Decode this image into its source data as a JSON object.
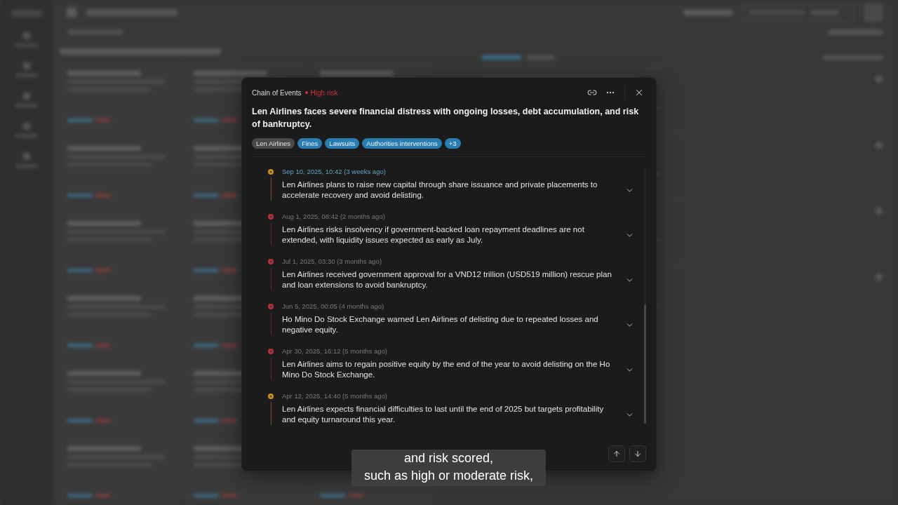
{
  "dialog": {
    "label": "Chain of Events",
    "risk": {
      "kind": "high",
      "label": "High risk"
    },
    "title": "Len Airlines faces severe financial distress with ongoing losses, debt accumulation, and risk of bankruptcy.",
    "tags": [
      {
        "kind": "entity",
        "label": "Len Airlines"
      },
      {
        "kind": "topic",
        "label": "Fines"
      },
      {
        "kind": "topic",
        "label": "Lawsuits"
      },
      {
        "kind": "topic",
        "label": "Authorities interventions"
      },
      {
        "kind": "more",
        "label": "+3"
      }
    ],
    "events": [
      {
        "date": "Sep 10, 2025, 10:42 (3 weeks ago)",
        "text": "Len Airlines plans to raise new capital through share issuance and private placements to accelerate recovery and avoid delisting.",
        "color": "#c98f22",
        "selected": true,
        "expanded": false
      },
      {
        "date": "Aug 1, 2025, 08:42 (2 months ago)",
        "text": "Len Airlines risks insolvency if government-backed loan repayment deadlines are not extended, with liquidity issues expected as early as July.",
        "color": "#b3323c",
        "selected": false,
        "expanded": false
      },
      {
        "date": "Jul 1, 2025, 03:30 (3 months ago)",
        "text": "Len Airlines received government approval for a VND12 trillion (USD519 million) rescue plan and loan extensions to avoid bankruptcy.",
        "color": "#b3323c",
        "selected": false,
        "expanded": false
      },
      {
        "date": "Jun 5, 2025, 00:05 (4 months ago)",
        "text": "Ho Mino Do Stock Exchange warned Len Airlines of delisting due to repeated losses and negative equity.",
        "color": "#b3323c",
        "selected": false,
        "expanded": false
      },
      {
        "date": "Apr 30, 2025, 16:12 (5 months ago)",
        "text": "Len Airlines aims to regain positive equity by the end of the year to avoid delisting on the Ho Mino Do Stock Exchange.",
        "color": "#b3323c",
        "selected": false,
        "expanded": false
      },
      {
        "date": "Apr 12, 2025, 14:40 (5 months ago)",
        "text": "Len Airlines expects financial difficulties to last until the end of 2025 but targets profitability and equity turnaround this year.",
        "color": "#c98f22",
        "selected": false,
        "expanded": false
      }
    ]
  },
  "caption": {
    "lines": [
      "and risk scored,",
      "such as high or moderate risk,"
    ]
  }
}
